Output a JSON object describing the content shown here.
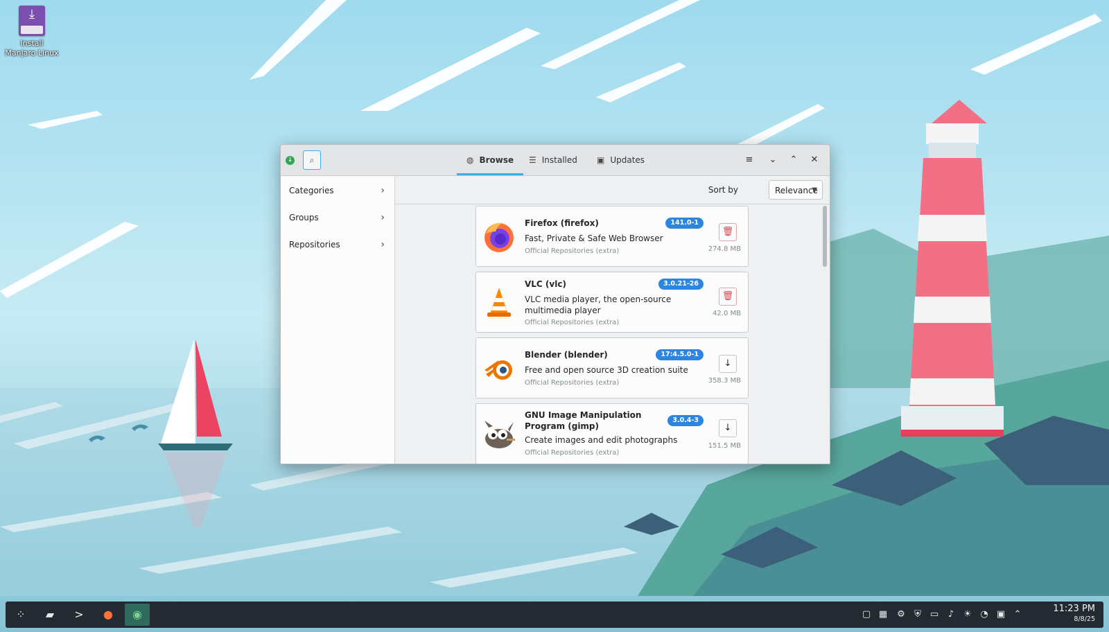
{
  "desktop": {
    "icon_label": "Install Manjaro Linux"
  },
  "window": {
    "tabs": [
      {
        "label": "Browse",
        "icon": "globe-icon",
        "active": true
      },
      {
        "label": "Installed",
        "icon": "list-icon",
        "active": false
      },
      {
        "label": "Updates",
        "icon": "package-icon",
        "active": false
      }
    ],
    "sidebar": [
      {
        "label": "Categories"
      },
      {
        "label": "Groups"
      },
      {
        "label": "Repositories"
      }
    ],
    "sort": {
      "label": "Sort by",
      "value": "Relevance"
    },
    "packages": [
      {
        "name": "Firefox (firefox)",
        "description": "Fast, Private & Safe Web Browser",
        "repo": "Official Repositories (extra)",
        "version": "141.0-1",
        "size": "274.8 MB",
        "action": "remove",
        "action_icon": "trash-icon"
      },
      {
        "name": "VLC (vlc)",
        "description": "VLC media player, the open-source multimedia player",
        "repo": "Official Repositories (extra)",
        "version": "3.0.21-26",
        "size": "42.0 MB",
        "action": "remove",
        "action_icon": "trash-icon"
      },
      {
        "name": "Blender (blender)",
        "description": "Free and open source 3D creation suite",
        "repo": "Official Repositories (extra)",
        "version": "17:4.5.0-1",
        "size": "358.3 MB",
        "action": "install",
        "action_icon": "download-icon"
      },
      {
        "name": "GNU Image Manipulation Program (gimp)",
        "description": "Create images and edit photographs",
        "repo": "Official Repositories (extra)",
        "version": "3.0.4-3",
        "size": "151.5 MB",
        "action": "install",
        "action_icon": "download-icon"
      }
    ]
  },
  "taskbar": {
    "time": "11:23 PM",
    "date": "8/8/25"
  },
  "colors": {
    "accent": "#3daee9",
    "version_badge": "#2c86e0",
    "remove_red": "#da4453",
    "taskbar": "#232a31"
  }
}
